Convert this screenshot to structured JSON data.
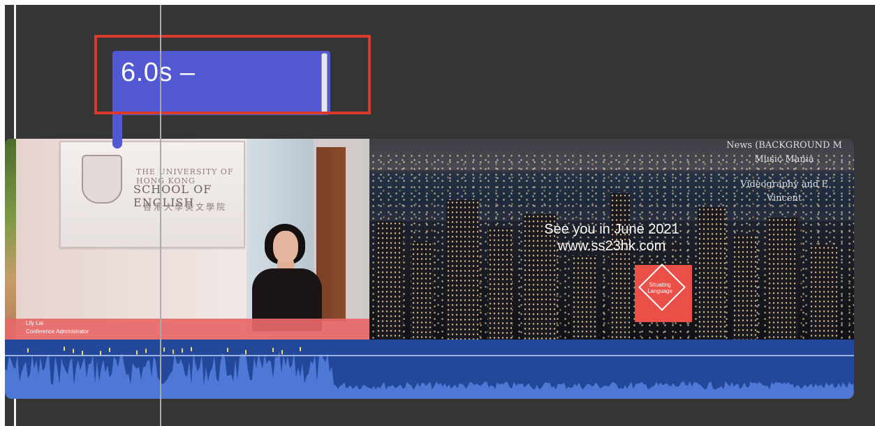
{
  "title_clip": {
    "label": "6.0s –"
  },
  "lower_third": {
    "name": "Lily Lai",
    "role": "Conference Administrator"
  },
  "sign": {
    "line1": "THE UNIVERSITY OF HONG KONG",
    "line2": "SCHOOL OF ENGLISH",
    "line3": "香港大學英文學院"
  },
  "city_clip": {
    "line1": "See you in June 2021",
    "line2": "www.ss23hk.com"
  },
  "credits": {
    "line1": "News (BACKGROUND M",
    "line2": "Music Mania",
    "line3": "Videography and E",
    "line4": "Vincent"
  },
  "logo": {
    "text1": "Situating",
    "text2": "Language"
  },
  "colors": {
    "title_clip": "#5158d2",
    "highlight": "#d93a2c",
    "audio_track": "#23489a",
    "audio_wave": "#4d78d6",
    "lower_third": "#e76868"
  }
}
